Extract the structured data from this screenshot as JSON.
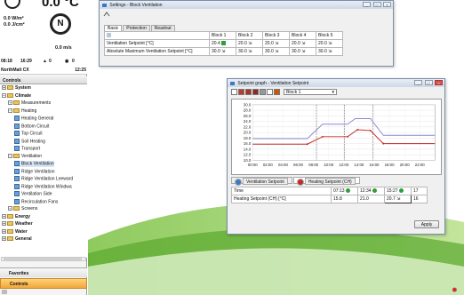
{
  "weather": {
    "temperature": "0.0 °C",
    "radiation_1": "0.0 W/m²",
    "radiation_2": "0.0 J/cm²",
    "compass": "N",
    "wind": "0.0 m/s",
    "sunrise": "08:18",
    "sunset": "16:29",
    "alarms": "0",
    "messages": "0"
  },
  "site": {
    "name": "NorthMalt CX",
    "time": "12:25"
  },
  "sidebar": {
    "header": "Controls",
    "favorites": "Favorites",
    "controls_tab": "Controls"
  },
  "tree": [
    {
      "label": "System",
      "type": "folder",
      "level": 0,
      "bold": true,
      "expander": "+"
    },
    {
      "label": "Climate",
      "type": "folder",
      "level": 0,
      "bold": true,
      "expander": "−"
    },
    {
      "label": "Measurements",
      "type": "folder",
      "level": 1,
      "expander": "+"
    },
    {
      "label": "Heating",
      "type": "folder",
      "level": 1,
      "expander": "−"
    },
    {
      "label": "Heating General",
      "type": "doc",
      "level": 2
    },
    {
      "label": "Bottom Circuit",
      "type": "doc",
      "level": 2
    },
    {
      "label": "Top Circuit",
      "type": "doc",
      "level": 2
    },
    {
      "label": "Soil Heating",
      "type": "doc",
      "level": 2
    },
    {
      "label": "Transport",
      "type": "doc",
      "level": 2
    },
    {
      "label": "Ventilation",
      "type": "folder",
      "level": 1,
      "expander": "−"
    },
    {
      "label": "Block Ventilation",
      "type": "doc",
      "level": 2,
      "selected": true
    },
    {
      "label": "Ridge Ventilation",
      "type": "doc",
      "level": 2
    },
    {
      "label": "Ridge Ventilation Leeward",
      "type": "doc",
      "level": 2
    },
    {
      "label": "Ridge Ventilation Windwa",
      "type": "doc",
      "level": 2
    },
    {
      "label": "Ventilation Side",
      "type": "doc",
      "level": 2
    },
    {
      "label": "Recirculation Fans",
      "type": "doc",
      "level": 2
    },
    {
      "label": "Screens",
      "type": "folder",
      "level": 1,
      "expander": "+"
    },
    {
      "label": "Energy",
      "type": "folder",
      "level": 0,
      "bold": true,
      "expander": "+"
    },
    {
      "label": "Weather",
      "type": "folder",
      "level": 0,
      "bold": true,
      "expander": "+"
    },
    {
      "label": "Water",
      "type": "folder",
      "level": 0,
      "bold": true,
      "expander": "+"
    },
    {
      "label": "General",
      "type": "folder",
      "level": 0,
      "bold": true,
      "expander": "+"
    }
  ],
  "settings_window": {
    "title": "Settings - Block Ventilation",
    "tabs": [
      "Basic",
      "Protection",
      "Readout"
    ],
    "columns": [
      "Block 1",
      "Block 2",
      "Block 3",
      "Block 4",
      "Block 5"
    ],
    "rows": [
      {
        "label": "Ventilation Setpoint [°C]",
        "values": [
          "20.4",
          "20.0",
          "20.0",
          "20.0",
          "20.0"
        ]
      },
      {
        "label": "Absolute Maximum Ventilation Setpoint [°C]",
        "values": [
          "30.0",
          "30.0",
          "30.0",
          "30.0",
          "30.0"
        ]
      }
    ]
  },
  "graph_window": {
    "title": "Setpoint graph - Ventilation Setpoint",
    "combo": "Block 1",
    "legend": [
      "Ventilation Setpoint",
      "Heating Setpoint (CH)"
    ],
    "table_rows": [
      {
        "label": "Time",
        "values": [
          "07:13",
          "12:34",
          "15:27",
          "17"
        ]
      },
      {
        "label": "Heating Setpoint (CH) [°C]",
        "values": [
          "15.8",
          "21.0",
          "20.7",
          "16"
        ]
      }
    ],
    "apply": "Apply"
  },
  "chart_data": {
    "type": "line",
    "x": [
      "00:00",
      "02:00",
      "04:00",
      "06:00",
      "08:00",
      "10:00",
      "12:00",
      "14:00",
      "16:00",
      "18:00",
      "20:00",
      "22:00"
    ],
    "ylim": [
      10.0,
      30.0
    ],
    "yticks": [
      "30.0",
      "28.0",
      "26.0",
      "24.0",
      "22.0",
      "20.0",
      "18.0",
      "16.0",
      "14.0",
      "12.0",
      "10.0"
    ],
    "series": [
      {
        "name": "Ventilation Setpoint",
        "color": "#8a8ad0",
        "points": [
          [
            0,
            17.8
          ],
          [
            7.2,
            17.8
          ],
          [
            9.2,
            23.0
          ],
          [
            12.5,
            23.0
          ],
          [
            13.5,
            25.0
          ],
          [
            15.5,
            25.0
          ],
          [
            17.2,
            19.0
          ],
          [
            24,
            19.0
          ]
        ]
      },
      {
        "name": "Heating Setpoint (CH)",
        "color": "#c62828",
        "points": [
          [
            0,
            15.8
          ],
          [
            7.2,
            15.8
          ],
          [
            9.2,
            18.5
          ],
          [
            12.5,
            18.5
          ],
          [
            13.8,
            21.0
          ],
          [
            15.5,
            20.7
          ],
          [
            17.2,
            16.0
          ],
          [
            24,
            16.0
          ]
        ]
      }
    ],
    "markers": [
      8.4,
      12.1,
      15.8
    ]
  },
  "colors": {
    "accent": "#f2a73a",
    "heating": "#c62828",
    "ventilation": "#3b79c7"
  }
}
